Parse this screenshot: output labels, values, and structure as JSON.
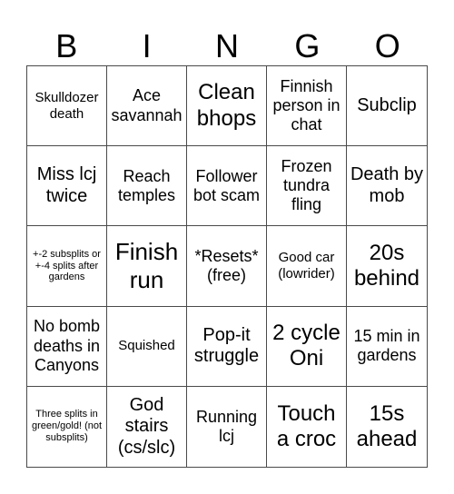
{
  "header": {
    "letters": [
      "B",
      "I",
      "N",
      "G",
      "O"
    ]
  },
  "board": {
    "rows": [
      [
        "Skulldozer death",
        "Ace savannah",
        "Clean bhops",
        "Finnish person in chat",
        "Subclip"
      ],
      [
        "Miss lcj twice",
        "Reach temples",
        "Follower bot scam",
        "Frozen tundra fling",
        "Death by mob"
      ],
      [
        "+-2 subsplits or +-4 splits after gardens",
        "Finish run",
        "*Resets* (free)",
        "Good car (lowrider)",
        "20s behind"
      ],
      [
        "No bomb deaths in Canyons",
        "Squished",
        "Pop-it struggle",
        "2 cycle Oni",
        "15 min in gardens"
      ],
      [
        "Three splits in green/gold! (not subsplits)",
        "God stairs (cs/slc)",
        "Running lcj",
        "Touch a croc",
        "15s ahead"
      ]
    ]
  }
}
